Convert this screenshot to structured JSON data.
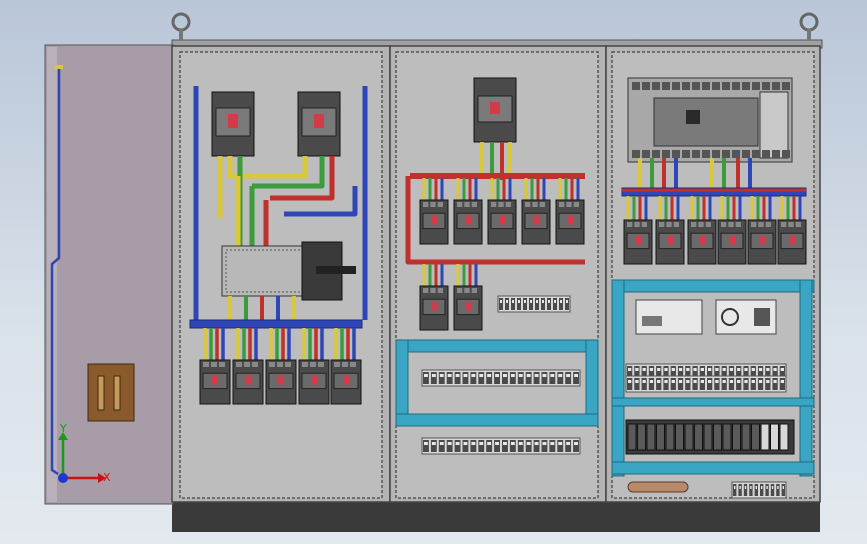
{
  "colors": {
    "background_top": "#b9c6d7",
    "background_bottom": "#e4e9ef",
    "cabinet_frame": "#9a9a9a",
    "plinth": "#3a3a3a",
    "door": "#a89ca8",
    "wire_red": "#c0302c",
    "wire_green": "#3c9b3c",
    "wire_yellow": "#d8c83a",
    "wire_blue": "#2f46b8",
    "trunking_teal": "#3aa6c4",
    "breaker_body": "#4a4a4a",
    "breaker_face": "#d23c4a"
  },
  "axes": {
    "x_label": "X",
    "y_label": "Y"
  },
  "icons": {
    "lifting_eye": "lifting-eye-icon",
    "door_handle": "door-handle-icon",
    "axis_triad": "axis-triad-icon"
  }
}
